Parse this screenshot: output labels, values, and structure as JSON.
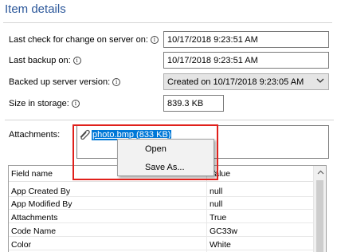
{
  "panel": {
    "title": "Item details"
  },
  "fields": {
    "last_check": {
      "label": "Last check for change on server on:",
      "value": "10/17/2018 9:23:51 AM"
    },
    "last_backup": {
      "label": "Last backup on:",
      "value": "10/17/2018 9:23:51 AM"
    },
    "server_version": {
      "label": "Backed up server version:",
      "value": "Created on 10/17/2018 9:23:05 AM"
    },
    "size": {
      "label": "Size in storage:",
      "value": "839.3 KB"
    },
    "info_glyph": "i"
  },
  "attachments": {
    "label": "Attachments:",
    "file": "photo.bmp (833 KB)"
  },
  "context_menu": {
    "items": [
      "Open",
      "Save As..."
    ]
  },
  "grid": {
    "header": {
      "name": "Field name",
      "value": "Value"
    },
    "rows": [
      {
        "name": "App Created By",
        "value": "null"
      },
      {
        "name": "App Modified By",
        "value": "null"
      },
      {
        "name": "Attachments",
        "value": "True"
      },
      {
        "name": "Code Name",
        "value": "GC33w"
      },
      {
        "name": "Color",
        "value": "White"
      }
    ]
  },
  "colors": {
    "title": "#2b579a",
    "selection": "#0078d7",
    "highlight": "#e0201b"
  },
  "icons": {
    "info": "info-icon",
    "attachment": "paperclip-icon",
    "dropdown": "chevron-down-icon",
    "scroll_up": "scroll-up-arrow-icon"
  }
}
